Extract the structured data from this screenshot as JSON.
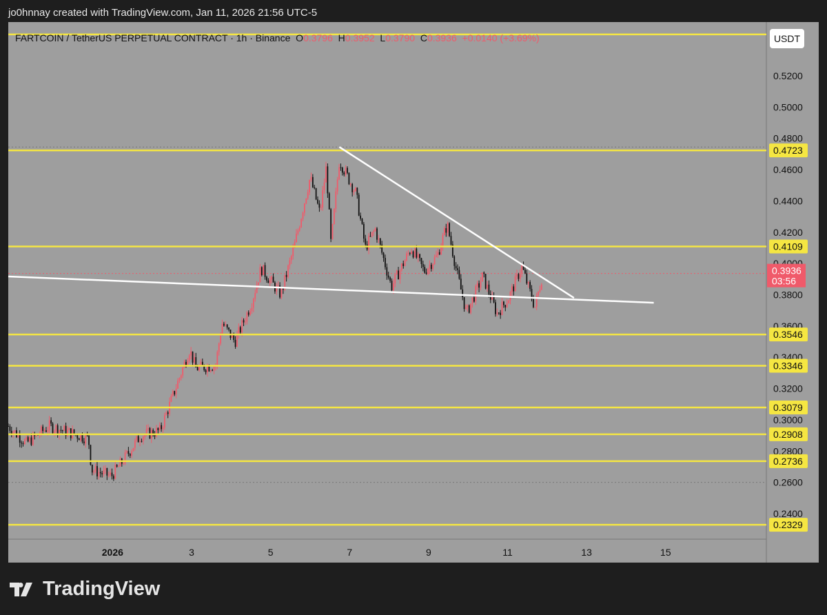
{
  "credit": "jo0hnnay created with TradingView.com, Jan 11, 2026 21:56 UTC-5",
  "legend": {
    "symbol": "FARTCOIN / TetherUS PERPETUAL CONTRACT · 1h · Binance",
    "o_label": "O",
    "o": "0.3796",
    "h_label": "H",
    "h": "0.3952",
    "l_label": "L",
    "l": "0.3790",
    "c_label": "C",
    "c": "0.3936",
    "change": "+0.0140 (+3.69%)"
  },
  "currency_button": "USDT",
  "brand": "TradingView",
  "colors": {
    "up": "#f05a6a",
    "down": "#111111",
    "level": "#f5e642",
    "trend": "#ffffff",
    "bg": "#9e9e9e"
  },
  "chart_data": {
    "type": "candlestick",
    "interval": "1h",
    "y_ticks": [
      "0.5200",
      "0.5000",
      "0.4800",
      "0.4600",
      "0.4400",
      "0.4200",
      "0.4000",
      "0.3800",
      "0.3600",
      "0.3400",
      "0.3200",
      "0.3000",
      "0.2800",
      "0.2600",
      "0.2400"
    ],
    "ylim": [
      0.222,
      0.568
    ],
    "x_ticks": [
      {
        "day": 1,
        "label": "2026"
      },
      {
        "day": 3,
        "label": "3"
      },
      {
        "day": 5,
        "label": "5"
      },
      {
        "day": 7,
        "label": "7"
      },
      {
        "day": 9,
        "label": "9"
      },
      {
        "day": 11,
        "label": "11"
      },
      {
        "day": 13,
        "label": "13"
      },
      {
        "day": 15,
        "label": "15"
      }
    ],
    "xlim": [
      -1.64,
      17.55
    ],
    "price_path_approx": [
      [
        -1.64,
        0.296
      ],
      [
        -1.18,
        0.285
      ],
      [
        -0.6,
        0.296
      ],
      [
        0.39,
        0.288
      ],
      [
        0.47,
        0.268
      ],
      [
        0.97,
        0.264
      ],
      [
        1.21,
        0.272
      ],
      [
        1.71,
        0.29
      ],
      [
        2.2,
        0.293
      ],
      [
        2.45,
        0.31
      ],
      [
        2.95,
        0.345
      ],
      [
        3.11,
        0.333
      ],
      [
        3.61,
        0.335
      ],
      [
        3.77,
        0.362
      ],
      [
        4.1,
        0.35
      ],
      [
        4.52,
        0.375
      ],
      [
        4.76,
        0.397
      ],
      [
        5.26,
        0.38
      ],
      [
        5.59,
        0.41
      ],
      [
        6.0,
        0.455
      ],
      [
        6.25,
        0.432
      ],
      [
        6.41,
        0.462
      ],
      [
        6.53,
        0.412
      ],
      [
        6.74,
        0.466
      ],
      [
        7.16,
        0.445
      ],
      [
        7.4,
        0.41
      ],
      [
        7.65,
        0.422
      ],
      [
        8.06,
        0.385
      ],
      [
        8.56,
        0.41
      ],
      [
        8.89,
        0.395
      ],
      [
        9.22,
        0.405
      ],
      [
        9.47,
        0.425
      ],
      [
        9.71,
        0.395
      ],
      [
        9.96,
        0.368
      ],
      [
        10.37,
        0.392
      ],
      [
        10.73,
        0.368
      ],
      [
        11.03,
        0.378
      ],
      [
        11.36,
        0.398
      ],
      [
        11.69,
        0.372
      ],
      [
        11.89,
        0.3936
      ]
    ],
    "levels": [
      {
        "price": 0.5465,
        "label": ""
      },
      {
        "price": 0.4723,
        "label": "0.4723"
      },
      {
        "price": 0.4109,
        "label": "0.4109"
      },
      {
        "price": 0.3546,
        "label": "0.3546"
      },
      {
        "price": 0.3346,
        "label": "0.3346"
      },
      {
        "price": 0.3079,
        "label": "0.3079"
      },
      {
        "price": 0.2908,
        "label": "0.2908"
      },
      {
        "price": 0.2736,
        "label": "0.2736"
      },
      {
        "price": 0.2329,
        "label": "0.2329"
      }
    ],
    "trendlines": [
      {
        "from": [
          6.74,
          0.4745
        ],
        "to": [
          12.68,
          0.378
        ]
      },
      {
        "from": [
          -1.64,
          0.3917
        ],
        "to": [
          14.7,
          0.3749
        ]
      }
    ],
    "last_price": {
      "price": 0.3936,
      "label": "0.3936",
      "countdown": "03:56"
    },
    "high_marker": 0.4745,
    "low_marker": 0.26
  }
}
